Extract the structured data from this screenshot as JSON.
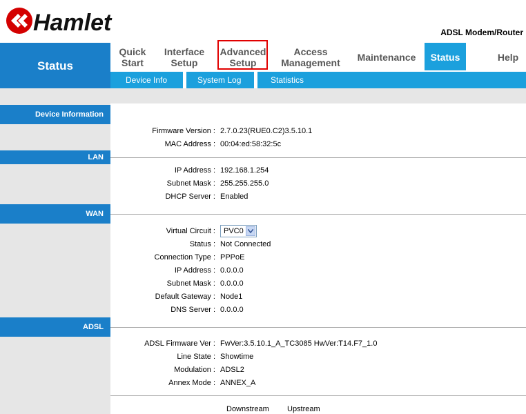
{
  "header": {
    "logo_text": "Hamlet",
    "product": "ADSL Modem/Router"
  },
  "nav": {
    "left_title": "Status",
    "items": [
      {
        "line1": "Quick",
        "line2": "Start"
      },
      {
        "line1": "Interface",
        "line2": "Setup"
      },
      {
        "line1": "Advanced",
        "line2": "Setup"
      },
      {
        "line1": "Access",
        "line2": "Management"
      },
      {
        "line1": "Maintenance",
        "line2": ""
      },
      {
        "line1": "Status",
        "line2": ""
      },
      {
        "line1": "Help",
        "line2": ""
      }
    ],
    "sub_items": [
      "Device Info",
      "System Log",
      "Statistics"
    ]
  },
  "sections": {
    "device": "Device Information",
    "lan": "LAN",
    "wan": "WAN",
    "adsl": "ADSL"
  },
  "device": {
    "fw_label": "Firmware Version :",
    "fw_value": "2.7.0.23(RUE0.C2)3.5.10.1",
    "mac_label": "MAC Address :",
    "mac_value": "00:04:ed:58:32:5c"
  },
  "lan": {
    "ip_label": "IP Address :",
    "ip_value": "192.168.1.254",
    "mask_label": "Subnet Mask :",
    "mask_value": "255.255.255.0",
    "dhcp_label": "DHCP Server :",
    "dhcp_value": "Enabled"
  },
  "wan": {
    "vc_label": "Virtual Circuit :",
    "vc_value": "PVC0",
    "status_label": "Status :",
    "status_value": "Not Connected",
    "conn_label": "Connection Type :",
    "conn_value": "PPPoE",
    "ip_label": "IP Address :",
    "ip_value": "0.0.0.0",
    "mask_label": "Subnet Mask :",
    "mask_value": "0.0.0.0",
    "gw_label": "Default Gateway :",
    "gw_value": "Node1",
    "dns_label": "DNS Server :",
    "dns_value": "0.0.0.0"
  },
  "adsl": {
    "fw_label": "ADSL Firmware Ver :",
    "fw_value": "FwVer:3.5.10.1_A_TC3085 HwVer:T14.F7_1.0",
    "line_label": "Line State :",
    "line_value": "Showtime",
    "mod_label": "Modulation :",
    "mod_value": "ADSL2",
    "annex_label": "Annex Mode :",
    "annex_value": "ANNEX_A",
    "col_down": "Downstream",
    "col_up": "Upstream"
  },
  "colors": {
    "nav_blue": "#1a7fc9",
    "sub_blue": "#1ba0dd",
    "highlight_red": "#e10000"
  }
}
